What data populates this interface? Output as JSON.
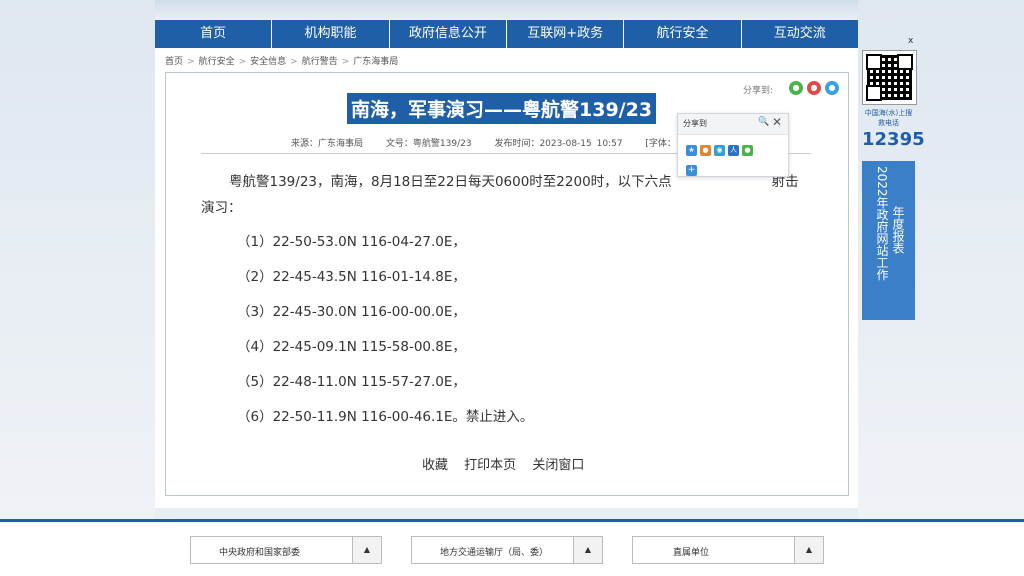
{
  "nav": [
    "首页",
    "机构职能",
    "政府信息公开",
    "互联网+政务",
    "航行安全",
    "互动交流"
  ],
  "breadcrumb": [
    "首页",
    "航行安全",
    "安全信息",
    "航行警告",
    "广东海事局"
  ],
  "breadcrumb_sep": ">",
  "share": {
    "label": "分享到:",
    "popup_title": "分享到",
    "search_glyph": "🔍",
    "close_glyph": "✕",
    "plus_glyph": "+",
    "icons": [
      "wechat-icon",
      "weibo-icon",
      "qq-icon"
    ]
  },
  "article": {
    "title": "南海，军事演习——粤航警139/23",
    "source": "来源：广东海事局",
    "doc_no": "文号：粤航警139/23",
    "published": "发布时间：2023-08-15 10:57",
    "font_size": "[字体：",
    "paragraph_1": "粤航警139/23，南海，8月18日至22日每天0600时至2200时，以下六点",
    "paragraph_1_tail": "射击",
    "paragraph_1_cont": "演习：",
    "points": [
      "（1）22-50-53.0N 116-04-27.0E，",
      "（2）22-45-43.5N 116-01-14.8E，",
      "（3）22-45-30.0N 116-00-00.0E，",
      "（4）22-45-09.1N 115-58-00.8E，",
      "（5）22-48-11.0N 115-57-27.0E，",
      "（6）22-50-11.9N 116-00-46.1E。禁止进入。"
    ],
    "actions": [
      "收藏",
      "打印本页",
      "关闭窗口"
    ]
  },
  "sidebar": {
    "close": "x",
    "hotline_caption": "中国海(水)上搜救电话",
    "hotline_number": "12395",
    "report_col1": "2022年政府网站工作",
    "report_col2": "年度报表"
  },
  "footer": {
    "selects": [
      "中央政府和国家部委",
      "地方交通运输厅（局、委）",
      "直属单位"
    ],
    "arrow": "▲"
  }
}
